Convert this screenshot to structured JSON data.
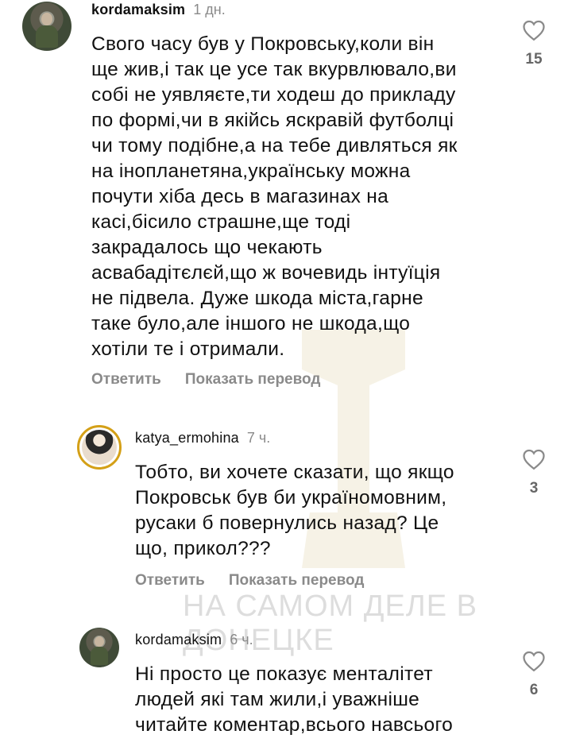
{
  "comments": [
    {
      "username": "kordamaksim",
      "time": "1 дн.",
      "text": "Свого часу був у Покровську,коли він\nще жив,і так це усе так вкурвлювало,ви\nсобі не уявляєте,ти ходеш до прикладу\nпо формі,чи в якійсь яскравій футболці\nчи тому подібне,а на тебе дивляться як\nна інопланетяна,українську можна\nпочути хіба десь в магазинах на\nкасі,бісило страшне,ще тоді\nзакрадалось що чекають\nасвабадітєлєй,що ж вочевидь інтуїція\nне підвела. Дуже шкода міста,гарне\nтаке було,але іншого не шкода,що\nхотіли те і отримали.",
      "reply_label": "Ответить",
      "translate_label": "Показать перевод",
      "likes": "15"
    },
    {
      "username": "katya_ermohina",
      "time": "7 ч.",
      "text": "Тобто, ви хочете сказати, що якщо\nПокровськ був би україномовним,\nрусаки б повернулись назад? Це\nщо, прикол???",
      "reply_label": "Ответить",
      "translate_label": "Показать перевод",
      "likes": "3"
    },
    {
      "username": "kordamaksim",
      "time": "6 ч.",
      "text": "Ні просто це показує менталітет\nлюдей які там жили,і уважніше\nчитайте коментар,всього навсього",
      "likes": "6"
    }
  ],
  "watermark": "НА САМОМ ДЕЛЕ В ДОНЕЦКЕ",
  "colors": {
    "text": "#111111",
    "muted": "#8a8a8a",
    "story_ring": "#d4a017"
  }
}
